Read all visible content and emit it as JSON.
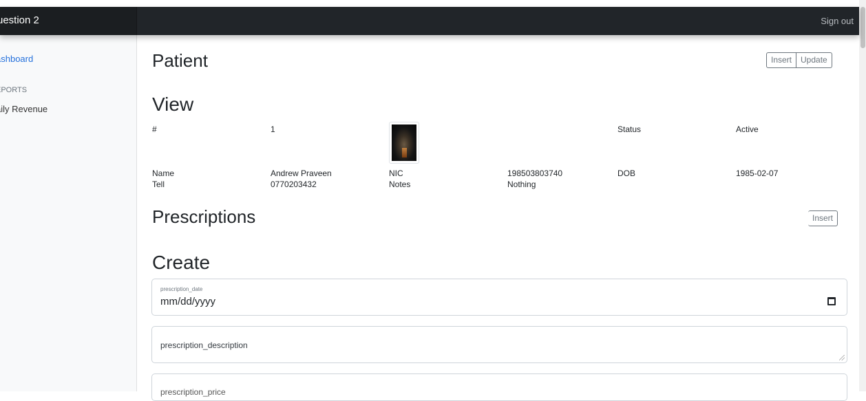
{
  "navbar": {
    "brand": "uestion 2",
    "sign_out": "Sign out"
  },
  "sidebar": {
    "dashboard": "ashboard",
    "reports_heading": "EPORTS",
    "daily_revenue": "aily Revenue"
  },
  "patient": {
    "title": "Patient",
    "insert_label": "Insert",
    "update_label": "Update"
  },
  "view": {
    "title": "View",
    "id_label": "#",
    "id_value": "1",
    "status_label": "Status",
    "status_value": "Active",
    "name_label": "Name",
    "name_value": "Andrew Praveen",
    "nic_label": "NIC",
    "nic_value": "198503803740",
    "dob_label": "DOB",
    "dob_value": "1985-02-07",
    "tell_label": "Tell",
    "tell_value": "0770203432",
    "notes_label": "Notes",
    "notes_value": "Nothing"
  },
  "prescriptions": {
    "title": "Prescriptions",
    "insert_label": "Insert"
  },
  "create": {
    "title": "Create",
    "date_label": "prescription_date",
    "date_value": "mm/dd/yyyy",
    "description_placeholder": "prescription_description",
    "price_placeholder": "prescription_price"
  },
  "icons": {
    "calendar": "calendar-icon",
    "resize": "resize-handle-icon"
  }
}
